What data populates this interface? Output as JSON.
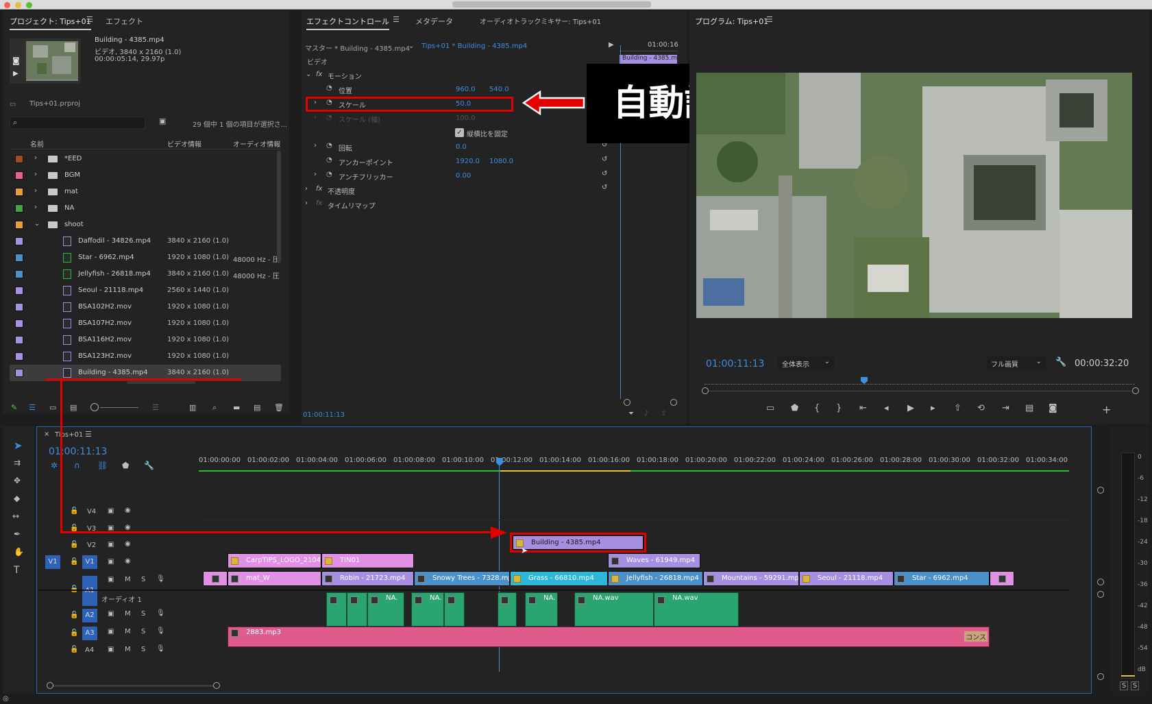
{
  "project_panel": {
    "tab_project": "プロジェクト: Tips+01",
    "tab_effects": "エフェクト",
    "clip_name": "Building - 4385.mp4",
    "clip_info_1": "ビデオ, 3840 x 2160 (1.0)",
    "clip_info_2": "00:00:05:14, 29.97p",
    "project_file": "Tips+01.prproj",
    "search_placeholder": "",
    "selection_status": "29 個中 1 個の項目が選択さ...",
    "col_name": "名前",
    "col_video": "ビデオ情報",
    "col_audio": "オーディオ情報",
    "items": [
      {
        "label": "*EED",
        "type": "folder",
        "color": "#9b4e21",
        "video": "",
        "audio": ""
      },
      {
        "label": "BGM",
        "type": "folder",
        "color": "#e75f8a",
        "video": "",
        "audio": ""
      },
      {
        "label": "mat",
        "type": "folder",
        "color": "#e8a13a",
        "video": "",
        "audio": ""
      },
      {
        "label": "NA",
        "type": "folder",
        "color": "#3da745",
        "video": "",
        "audio": ""
      },
      {
        "label": "shoot",
        "type": "folder-open",
        "color": "#e8a13a",
        "video": "",
        "audio": ""
      },
      {
        "label": "Daffodil - 34826.mp4",
        "type": "video",
        "color": "#a68ee0",
        "video": "3840 x 2160 (1.0)",
        "audio": ""
      },
      {
        "label": "Star - 6962.mp4",
        "type": "av",
        "color": "#4a90c9",
        "video": "1920 x 1080 (1.0)",
        "audio": "48000 Hz - 圧"
      },
      {
        "label": "Jellyfish - 26818.mp4",
        "type": "av",
        "color": "#4a90c9",
        "video": "3840 x 2160 (1.0)",
        "audio": "48000 Hz - 圧"
      },
      {
        "label": "Seoul - 21118.mp4",
        "type": "video",
        "color": "#a68ee0",
        "video": "2560 x 1440 (1.0)",
        "audio": ""
      },
      {
        "label": "BSA102H2.mov",
        "type": "video",
        "color": "#a68ee0",
        "video": "1920 x 1080 (1.0)",
        "audio": ""
      },
      {
        "label": "BSA107H2.mov",
        "type": "video",
        "color": "#a68ee0",
        "video": "1920 x 1080 (1.0)",
        "audio": ""
      },
      {
        "label": "BSA116H2.mov",
        "type": "video",
        "color": "#a68ee0",
        "video": "1920 x 1080 (1.0)",
        "audio": ""
      },
      {
        "label": "BSA123H2.mov",
        "type": "video",
        "color": "#a68ee0",
        "video": "1920 x 1080 (1.0)",
        "audio": ""
      },
      {
        "label": "Building - 4385.mp4",
        "type": "video",
        "color": "#a68ee0",
        "video": "3840 x 2160 (1.0)",
        "audio": ""
      }
    ]
  },
  "effect_controls": {
    "tab_effect_controls": "エフェクトコントロール",
    "tab_metadata": "メタデータ",
    "tab_audio_mixer": "オーディオトラックミキサー: Tips+01",
    "master_label": "マスター * Building - 4385.mp4",
    "sequence_clip_label": "Tips+01 * Building - 4385.mp4",
    "video_section": "ビデオ",
    "motion": "モーション",
    "position": "位置",
    "position_x": "960.0",
    "position_y": "540.0",
    "scale": "スケール",
    "scale_value": "50.0",
    "scale_width": "スケール (幅)",
    "scale_width_value": "100.0",
    "uniform_scale": "縦横比を固定",
    "rotation": "回転",
    "rotation_value": "0.0",
    "anchor": "アンカーポイント",
    "anchor_x": "1920.0",
    "anchor_y": "1080.0",
    "antiflicker": "アンチフリッカー",
    "antiflicker_value": "0.00",
    "opacity": "不透明度",
    "time_remap": "タイムリマップ",
    "mini_timecode": "01:00:16",
    "mini_clip_label": "Building - 4385.m",
    "bottom_timecode": "01:00:11:13"
  },
  "annotation": {
    "callout_text": "自動調整"
  },
  "program_monitor": {
    "title": "プログラム: Tips+01",
    "timecode": "01:00:11:13",
    "zoom": "全体表示",
    "quality": "フル画質",
    "duration": "00:00:32:20"
  },
  "timeline": {
    "sequence_tab": "Tips+01",
    "timecode": "01:00:11:13",
    "ruler": [
      "01:00:00:00",
      "01:00:02:00",
      "01:00:04:00",
      "01:00:06:00",
      "01:00:08:00",
      "01:00:10:00",
      "01:00:12:00",
      "01:00:14:00",
      "01:00:16:00",
      "01:00:18:00",
      "01:00:20:00",
      "01:00:22:00",
      "01:00:24:00",
      "01:00:26:00",
      "01:00:28:00",
      "01:00:30:00",
      "01:00:32:00",
      "01:00:34:00"
    ],
    "tracks": {
      "v4": "V4",
      "v3": "V3",
      "v2": "V2",
      "v1": "V1",
      "v1_source": "V1",
      "a1": "A1",
      "a1_name": "オーディオ 1",
      "a2": "A2",
      "a3": "A3",
      "a4": "A4",
      "mute": "M",
      "solo": "S"
    },
    "clips_v3": [
      {
        "label": "Building - 4385.mp4"
      }
    ],
    "clips_v2": [
      {
        "label": "CarpTIPS_LOGO_2104"
      },
      {
        "label": "TIN01"
      },
      {
        "label": "Waves - 61949.mp4"
      }
    ],
    "clips_v1": [
      {
        "label": "mat_W"
      },
      {
        "label": "Robin - 21723.mp4"
      },
      {
        "label": "Snowy Trees - 7328.mp"
      },
      {
        "label": "Grass - 66810.mp4"
      },
      {
        "label": "Jellyfish - 26818.mp4"
      },
      {
        "label": "Mountains - 59291.mp4"
      },
      {
        "label": "Seoul - 21118.mp4"
      },
      {
        "label": "Star - 6962.mp4"
      }
    ],
    "clips_a1": [
      "NA.",
      "NA.",
      "NA.",
      "NA.wav",
      "NA.wav"
    ],
    "clip_a2": "2883.mp3",
    "clip_a2_tail": "コンス",
    "meter_labels": [
      "0",
      "-6",
      "-12",
      "-18",
      "-24",
      "-30",
      "-36",
      "-42",
      "-48",
      "-54",
      "dB"
    ],
    "meter_solo": "S"
  }
}
